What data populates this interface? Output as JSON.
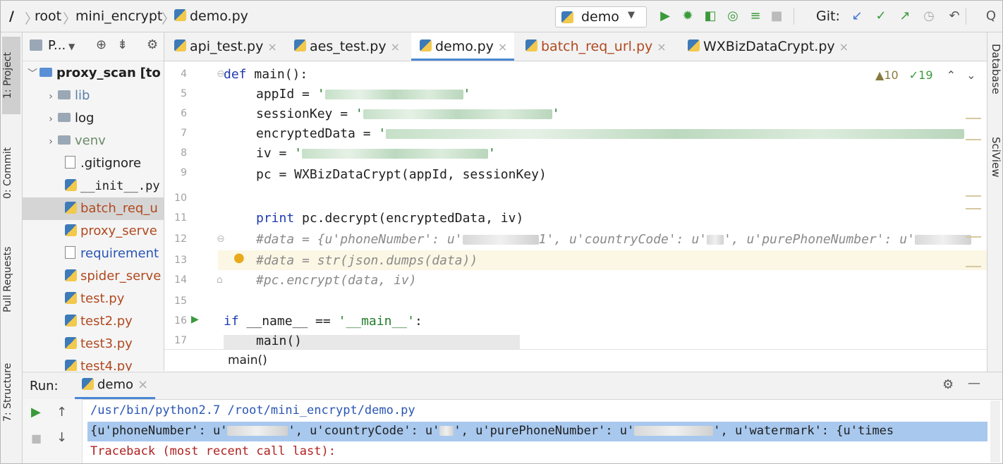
{
  "navbar": {
    "breadcrumbs": [
      "/",
      "root",
      "mini_encrypt",
      "demo.py"
    ],
    "run_config": "demo",
    "git_label": "Git:"
  },
  "left_tools": [
    "1: Project",
    "0: Commit",
    "Pull Requests",
    "7: Structure"
  ],
  "right_tools": [
    "Database",
    "SciView"
  ],
  "project": {
    "header_label": "P...",
    "root": {
      "name": "proxy_scan",
      "suffix": "[to"
    },
    "items": [
      {
        "name": "lib",
        "kind": "folder"
      },
      {
        "name": "log",
        "kind": "folder"
      },
      {
        "name": "venv",
        "kind": "folder"
      },
      {
        "name": ".gitignore",
        "kind": "file"
      },
      {
        "name": "__init__.py",
        "kind": "py"
      },
      {
        "name": "batch_req_u",
        "kind": "py"
      },
      {
        "name": "proxy_serve",
        "kind": "py"
      },
      {
        "name": "requirement",
        "kind": "txt"
      },
      {
        "name": "spider_serve",
        "kind": "py"
      },
      {
        "name": "test.py",
        "kind": "py"
      },
      {
        "name": "test2.py",
        "kind": "py"
      },
      {
        "name": "test3.py",
        "kind": "py"
      },
      {
        "name": "test4.py",
        "kind": "py"
      }
    ]
  },
  "tabs": [
    "api_test.py",
    "aes_test.py",
    "demo.py",
    "batch_req_url.py",
    "WXBizDataCrypt.py"
  ],
  "inspection": {
    "warnings": "10",
    "typos": "19"
  },
  "editor": {
    "line_numbers": [
      "4",
      "5",
      "6",
      "7",
      "8",
      "9",
      "10",
      "11",
      "12",
      "13",
      "14",
      "15",
      "16",
      "17"
    ],
    "def_kw": "def",
    "def_rest": " main():",
    "l5": "appId = ",
    "l6": "sessionKey = ",
    "l7": "encryptedData = ",
    "l8": "iv = ",
    "l9": "pc = WXBizDataCrypt(appId, sessionKey)",
    "print_kw": "print",
    "l11_rest": " pc.decrypt(encryptedData, iv)",
    "l12a": "#data = {u'phoneNumber': u'",
    "l12b": "1', u'countryCode': u'",
    "l12c": "', u'purePhoneNumber': u'",
    "l13": "#data = str(json.dumps(data))",
    "l14": "#pc.encrypt(data, iv)",
    "if_kw": "if",
    "l16_mid": " __name__ == ",
    "l16_str": "'__main__'",
    "l16_end": ":",
    "l17": "main()",
    "quote": "'"
  },
  "code_breadcrumb": "main()",
  "run": {
    "label": "Run:",
    "tab": "demo",
    "cmd": "/usr/bin/python2.7 /root/mini_encrypt/demo.py",
    "out_a": "{u'phoneNumber': u'",
    "out_b": "', u'countryCode': u'",
    "out_c": "', u'purePhoneNumber': u'",
    "out_d": "', u'watermark': {u'times",
    "traceback": "Traceback (most recent call last):"
  }
}
